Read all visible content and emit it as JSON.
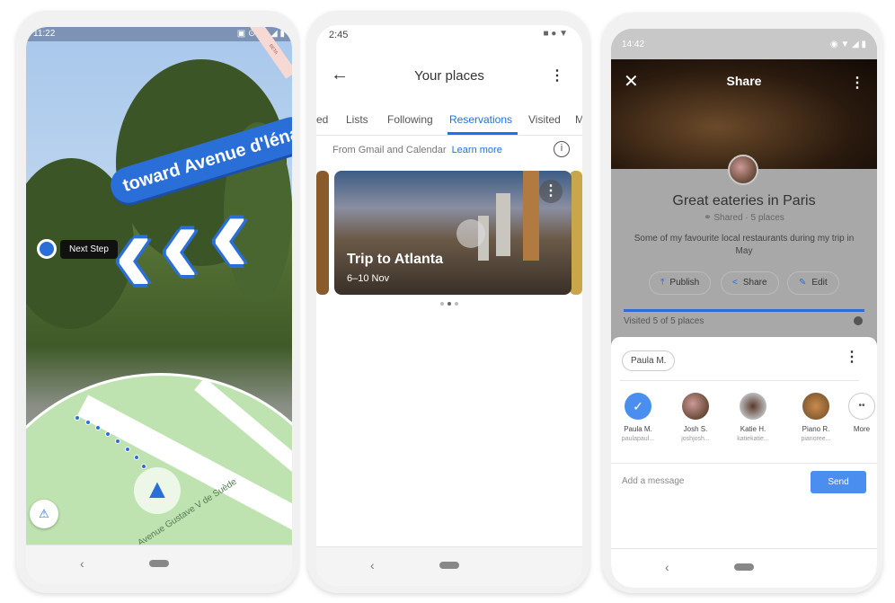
{
  "phone1": {
    "status": {
      "time": "11:22",
      "icons": "▲ ◉ ···",
      "right": "▣ ⊙ 40 ◢ ▮"
    },
    "beta": "BETA",
    "sign": "toward Avenue d'léna",
    "next_step": "Next Step",
    "street": "Avenue Gustave V de Suède",
    "icons": {
      "puck": "navigation-arrow-icon",
      "feedback": "feedback-icon"
    },
    "nav": {
      "back": "‹"
    }
  },
  "phone2": {
    "status": {
      "time": "2:45",
      "icons": "■ ● ▼"
    },
    "title": "Your places",
    "tabs": [
      "ed",
      "Lists",
      "Following",
      "Reservations",
      "Visited",
      "M"
    ],
    "active_tab": "Reservations",
    "info": {
      "text": "From Gmail and Calendar",
      "link": "Learn more"
    },
    "card": {
      "title": "Trip to Atlanta",
      "dates": "6–10 Nov"
    },
    "pager": {
      "count": 3,
      "active": 2
    },
    "nav": {
      "back": "‹"
    }
  },
  "phone3": {
    "status": {
      "time": "14:42",
      "icons": "◉ ▼ ◢ ▮"
    },
    "header": "Share",
    "list": {
      "title": "Great eateries in Paris",
      "meta": "⚭ Shared · 5 places",
      "description": "Some of my favourite local restaurants during my trip in May"
    },
    "actions": [
      {
        "icon": "⤒",
        "label": "Publish"
      },
      {
        "icon": "<",
        "label": "Share"
      },
      {
        "icon": "✎",
        "label": "Edit"
      }
    ],
    "progress": {
      "visited": 5,
      "total": 5,
      "text": "Visited 5 of 5 places"
    },
    "recipient_chip": "Paula M.",
    "contacts": [
      {
        "name": "Paula M.",
        "user": "paulapaul...",
        "selected": true
      },
      {
        "name": "Josh S.",
        "user": "joshjosh..."
      },
      {
        "name": "Katie H.",
        "user": "katiekatie..."
      },
      {
        "name": "Piano R.",
        "user": "pianoree..."
      },
      {
        "name": "More",
        "user": ""
      }
    ],
    "message_placeholder": "Add a message",
    "send": "Send",
    "nav": {
      "back": "‹"
    },
    "accent": "#4a8ef0"
  }
}
